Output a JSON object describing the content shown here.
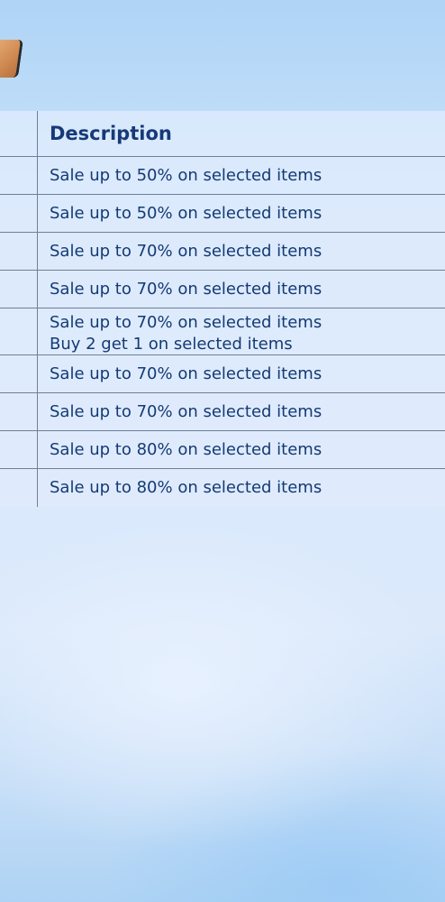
{
  "table": {
    "header": {
      "description": "Description"
    },
    "rows": [
      {
        "lines": [
          "Sale up to 50% on selected items"
        ]
      },
      {
        "lines": [
          "Sale up to 50% on selected items"
        ]
      },
      {
        "lines": [
          "Sale up to 70% on selected items"
        ]
      },
      {
        "lines": [
          "Sale up to 70% on selected items"
        ]
      },
      {
        "lines": [
          "Sale up to 70% on selected items",
          "Buy 2 get 1 on selected items"
        ]
      },
      {
        "lines": [
          "Sale up to 70% on selected items"
        ]
      },
      {
        "lines": [
          "Sale up to 70% on selected items"
        ]
      },
      {
        "lines": [
          "Sale up to 80% on selected items"
        ]
      },
      {
        "lines": [
          "Sale up to 80% on selected items"
        ]
      }
    ]
  },
  "colors": {
    "text": "#143a74",
    "grid": "#6f7f9a",
    "background_top": "#aed4f6",
    "background_mid": "#d9e9fc"
  },
  "icons": {
    "top_left": "decorative-badge-icon"
  }
}
